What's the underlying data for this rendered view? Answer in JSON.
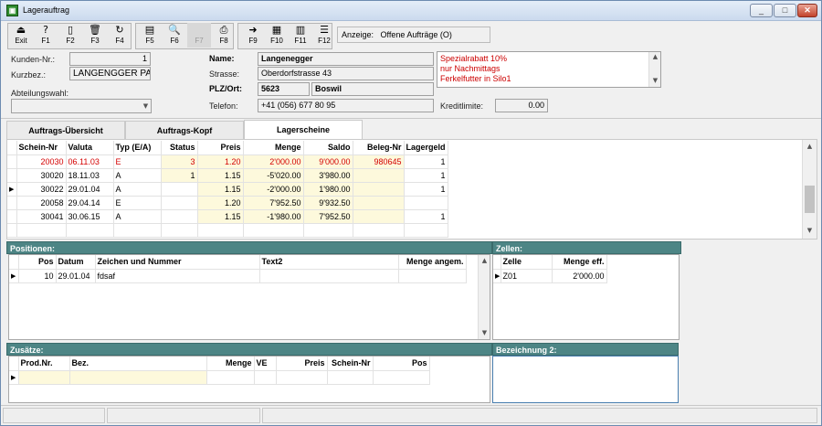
{
  "window": {
    "title": "Lagerauftrag",
    "btn_min": "_",
    "btn_max": "□",
    "btn_close": "✕"
  },
  "toolbar": [
    {
      "label": "Exit",
      "icon": "⏏",
      "name": "exit"
    },
    {
      "label": "F1",
      "icon": "?",
      "name": "help"
    },
    {
      "label": "F2",
      "icon": "▯",
      "name": "new"
    },
    {
      "label": "F3",
      "icon": "🗑",
      "name": "delete"
    },
    {
      "label": "F4",
      "icon": "↻",
      "name": "refresh"
    },
    {
      "label": "F5",
      "icon": "▤",
      "name": "edit"
    },
    {
      "label": "F6",
      "icon": "🔍",
      "name": "search"
    },
    {
      "label": "F7",
      "icon": "",
      "name": "f7"
    },
    {
      "label": "F8",
      "icon": "⎙",
      "name": "print"
    },
    {
      "label": "F9",
      "icon": "➜",
      "name": "export"
    },
    {
      "label": "F10",
      "icon": "▦",
      "name": "f10"
    },
    {
      "label": "F11",
      "icon": "▥",
      "name": "f11"
    },
    {
      "label": "F12",
      "icon": "☰",
      "name": "f12"
    }
  ],
  "anzeige": {
    "label": "Anzeige:",
    "value": "Offene Aufträge (O)"
  },
  "form": {
    "kunden_nr_label": "Kunden-Nr.:",
    "kunden_nr": "1",
    "kurzbez_label": "Kurzbez.:",
    "kurzbez": "LANGENGGER PAUL",
    "abteilung_label": "Abteilungswahl:",
    "abteilung": "",
    "name_label": "Name:",
    "name": "Langenegger",
    "strasse_label": "Strasse:",
    "strasse": "Oberdorfstrasse 43",
    "plzort_label": "PLZ/Ort:",
    "plz": "5623",
    "ort": "Boswil",
    "telefon_label": "Telefon:",
    "telefon": "+41 (056) 677 80 95",
    "memo": [
      "Spezialrabatt 10%",
      "nur Nachmittags",
      "Ferkelfutter in Silo1"
    ],
    "kreditlimite_label": "Kreditlimite:",
    "kreditlimite": "0.00"
  },
  "tabs": [
    "Auftrags-Übersicht",
    "Auftrags-Kopf",
    "Lagerscheine"
  ],
  "lagerscheine": {
    "columns": [
      "Schein-Nr",
      "Valuta",
      "Typ (E/A)",
      "Status",
      "Preis",
      "Menge",
      "Saldo",
      "Beleg-Nr",
      "Lagergeld"
    ],
    "rows": [
      [
        "20030",
        "06.11.03",
        "E",
        "3",
        "1.20",
        "2'000.00",
        "9'000.00",
        "980645",
        "1"
      ],
      [
        "30020",
        "18.11.03",
        "A",
        "1",
        "1.15",
        "-5'020.00",
        "3'980.00",
        "",
        "1"
      ],
      [
        "30022",
        "29.01.04",
        "A",
        "",
        "1.15",
        "-2'000.00",
        "1'980.00",
        "",
        "1"
      ],
      [
        "20058",
        "29.04.14",
        "E",
        "",
        "1.20",
        "7'952.50",
        "9'932.50",
        "",
        ""
      ],
      [
        "30041",
        "30.06.15",
        "A",
        "",
        "1.15",
        "-1'980.00",
        "7'952.50",
        "",
        "1"
      ]
    ]
  },
  "positionen": {
    "title": "Positionen:",
    "columns": [
      "Pos",
      "Datum",
      "Zeichen und Nummer",
      "Text2",
      "Menge angem."
    ],
    "rows": [
      [
        "10",
        "29.01.04",
        "fdsaf",
        "",
        ""
      ]
    ]
  },
  "zellen": {
    "title": "Zellen:",
    "columns": [
      "Zelle",
      "Menge eff."
    ],
    "rows": [
      [
        "Z01",
        "2'000.00"
      ]
    ]
  },
  "zusaetze": {
    "title": "Zusätze:",
    "columns": [
      "Prod.Nr.",
      "Bez.",
      "Menge",
      "VE",
      "Preis",
      "Schein-Nr",
      "Pos"
    ]
  },
  "bezeichnung2": {
    "title": "Bezeichnung 2:"
  },
  "colors": {
    "header_teal": "#4d8585",
    "selected_row": "#fdf9dc",
    "highlight": "#d40000"
  }
}
